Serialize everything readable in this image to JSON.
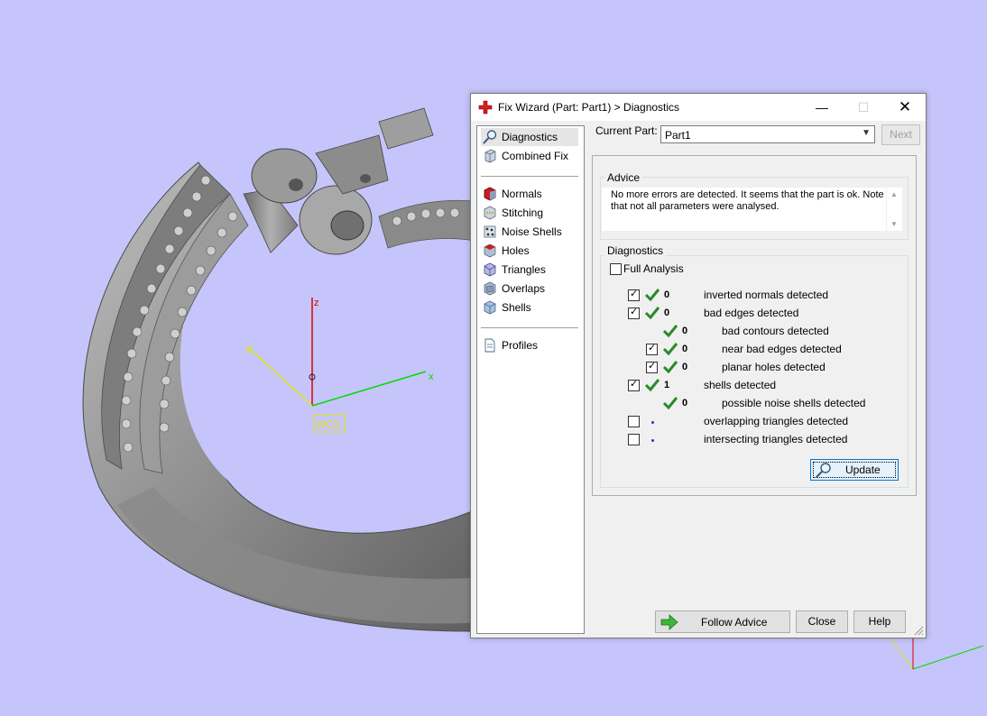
{
  "dialog": {
    "title": "Fix Wizard (Part: Part1) > Diagnostics",
    "minimize_icon": "minimize-icon",
    "maximize_icon": "maximize-icon",
    "close_icon": "close-icon"
  },
  "viewport": {
    "axis_z": "z",
    "axis_y": "y",
    "axis_x": "x",
    "wcs_label": "WCS",
    "colors": {
      "background": "#c5c5fb",
      "x_axis": "#00dd00",
      "y_axis": "#e8e800",
      "z_axis": "#dd0000"
    }
  },
  "sidebar": {
    "items_top": [
      {
        "label": "Diagnostics",
        "icon": "magnifier-icon",
        "selected": true
      },
      {
        "label": "Combined Fix",
        "icon": "cube-icon"
      }
    ],
    "items_fix": [
      {
        "label": "Normals",
        "icon": "normals-icon"
      },
      {
        "label": "Stitching",
        "icon": "stitching-icon"
      },
      {
        "label": "Noise Shells",
        "icon": "noise-shells-icon"
      },
      {
        "label": "Holes",
        "icon": "holes-icon"
      },
      {
        "label": "Triangles",
        "icon": "triangles-icon"
      },
      {
        "label": "Overlaps",
        "icon": "overlaps-icon"
      },
      {
        "label": "Shells",
        "icon": "shells-icon"
      }
    ],
    "items_bottom": [
      {
        "label": "Profiles",
        "icon": "document-icon"
      }
    ]
  },
  "header": {
    "current_part_label": "Current Part:",
    "current_part_value": "Part1",
    "next_label": "Next"
  },
  "advice": {
    "title": "Advice",
    "text": "No more errors are detected. It seems that the part is ok. Note that not all parameters were analysed."
  },
  "diagnostics": {
    "title": "Diagnostics",
    "full_analysis_label": "Full Analysis",
    "rows": [
      {
        "count": "0",
        "label": "inverted normals detected"
      },
      {
        "count": "0",
        "label": "bad edges detected"
      },
      {
        "count": "0",
        "label": "bad contours detected"
      },
      {
        "count": "0",
        "label": "near bad edges detected"
      },
      {
        "count": "0",
        "label": "planar holes detected"
      },
      {
        "count": "1",
        "label": "shells detected"
      },
      {
        "count": "0",
        "label": "possible noise shells detected"
      },
      {
        "count": "",
        "label": "overlapping triangles detected"
      },
      {
        "count": "",
        "label": "intersecting triangles detected"
      }
    ],
    "update_label": "Update"
  },
  "footer": {
    "follow_advice_label": "Follow Advice",
    "close_label": "Close",
    "help_label": "Help"
  }
}
